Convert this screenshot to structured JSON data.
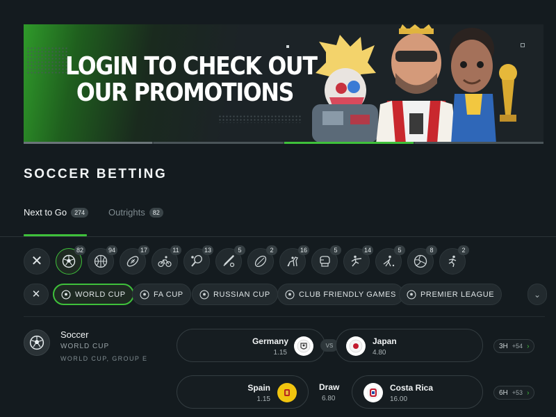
{
  "banner": {
    "line1": "LOGIN TO CHECK OUT",
    "line2": "OUR PROMOTIONS",
    "accent": "#3fc13b"
  },
  "section": {
    "title": "SOCCER BETTING"
  },
  "tabs": [
    {
      "label": "Next to Go",
      "count": "274",
      "active": true
    },
    {
      "label": "Outrights",
      "count": "82",
      "active": false
    }
  ],
  "sports": [
    {
      "icon": "soccer-ball-icon",
      "count": "82",
      "active": true
    },
    {
      "icon": "basketball-icon",
      "count": "94"
    },
    {
      "icon": "american-football-icon",
      "count": "17"
    },
    {
      "icon": "cycling-icon",
      "count": "11"
    },
    {
      "icon": "tennis-icon",
      "count": "13"
    },
    {
      "icon": "baseball-icon",
      "count": "5"
    },
    {
      "icon": "rugby-ball-icon",
      "count": "2"
    },
    {
      "icon": "horse-racing-icon",
      "count": "16"
    },
    {
      "icon": "boxing-icon",
      "count": "5"
    },
    {
      "icon": "martial-arts-icon",
      "count": "14"
    },
    {
      "icon": "golf-icon",
      "count": "5"
    },
    {
      "icon": "volleyball-icon",
      "count": "8"
    },
    {
      "icon": "athletics-icon",
      "count": "2"
    }
  ],
  "leagues": [
    {
      "label": "WORLD CUP",
      "active": true
    },
    {
      "label": "FA CUP"
    },
    {
      "label": "RUSSIAN CUP"
    },
    {
      "label": "CLUB FRIENDLY GAMES"
    },
    {
      "label": "PREMIER LEAGUE"
    }
  ],
  "match_group": {
    "sport": "Soccer",
    "competition": "WORLD CUP",
    "sub": "WORLD CUP, GROUP E"
  },
  "matches": [
    {
      "home": {
        "name": "Germany",
        "odds": "1.15"
      },
      "vs": "VS",
      "away": {
        "name": "Japan",
        "odds": "4.80"
      },
      "time": "3H",
      "more": "+54"
    },
    {
      "home": {
        "name": "Spain",
        "odds": "1.15"
      },
      "draw": {
        "name": "Draw",
        "odds": "6.80"
      },
      "away": {
        "name": "Costa Rica",
        "odds": "16.00"
      },
      "time": "6H",
      "more": "+53"
    }
  ]
}
